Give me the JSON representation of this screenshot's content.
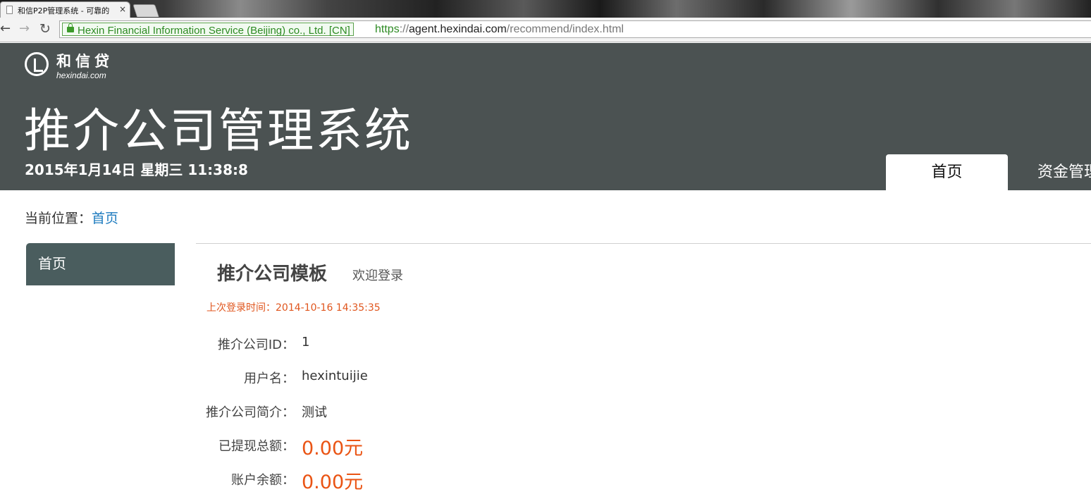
{
  "browser": {
    "tab_title": "和信P2P管理系统 - 可靠的",
    "tab_close": "×",
    "nav": {
      "back": "←",
      "forward": "→",
      "reload": "↻"
    },
    "ev_certificate": "Hexin Financial Information Service (Beijing) co., Ltd. [CN]",
    "url": {
      "scheme": "https",
      "separator": "://",
      "host": "agent.hexindai.com",
      "path": "/recommend/index.html"
    }
  },
  "header": {
    "logo_cn": "和信贷",
    "logo_en": "hexindai.com",
    "system_title": "推介公司管理系统",
    "datetime": "2015年1月14日  星期三  11:38:8",
    "nav": [
      {
        "label": "首页",
        "active": true
      },
      {
        "label": "资金管理",
        "active": false
      }
    ]
  },
  "breadcrumb": {
    "prefix": "当前位置：",
    "current": "首页"
  },
  "sidebar": {
    "items": [
      {
        "label": "首页",
        "active": true
      }
    ]
  },
  "main": {
    "title": "推介公司模板",
    "welcome": "欢迎登录",
    "last_login": "上次登录时间：2014-10-16 14:35:35",
    "fields": [
      {
        "label": "推介公司ID：",
        "value": "1"
      },
      {
        "label": "用户名：",
        "value": "hexintuijie"
      },
      {
        "label": "推介公司简介：",
        "value": "测试"
      },
      {
        "label": "已提现总额：",
        "value": "0.00元"
      },
      {
        "label": "账户余额：",
        "value": "0.00元"
      }
    ]
  },
  "colors": {
    "header_bg": "#4b5252",
    "sidebar_active_bg": "#4a5d5e",
    "link": "#1d7bbf",
    "accent_orange": "#ea5414",
    "ev_green": "#2e8b24"
  }
}
